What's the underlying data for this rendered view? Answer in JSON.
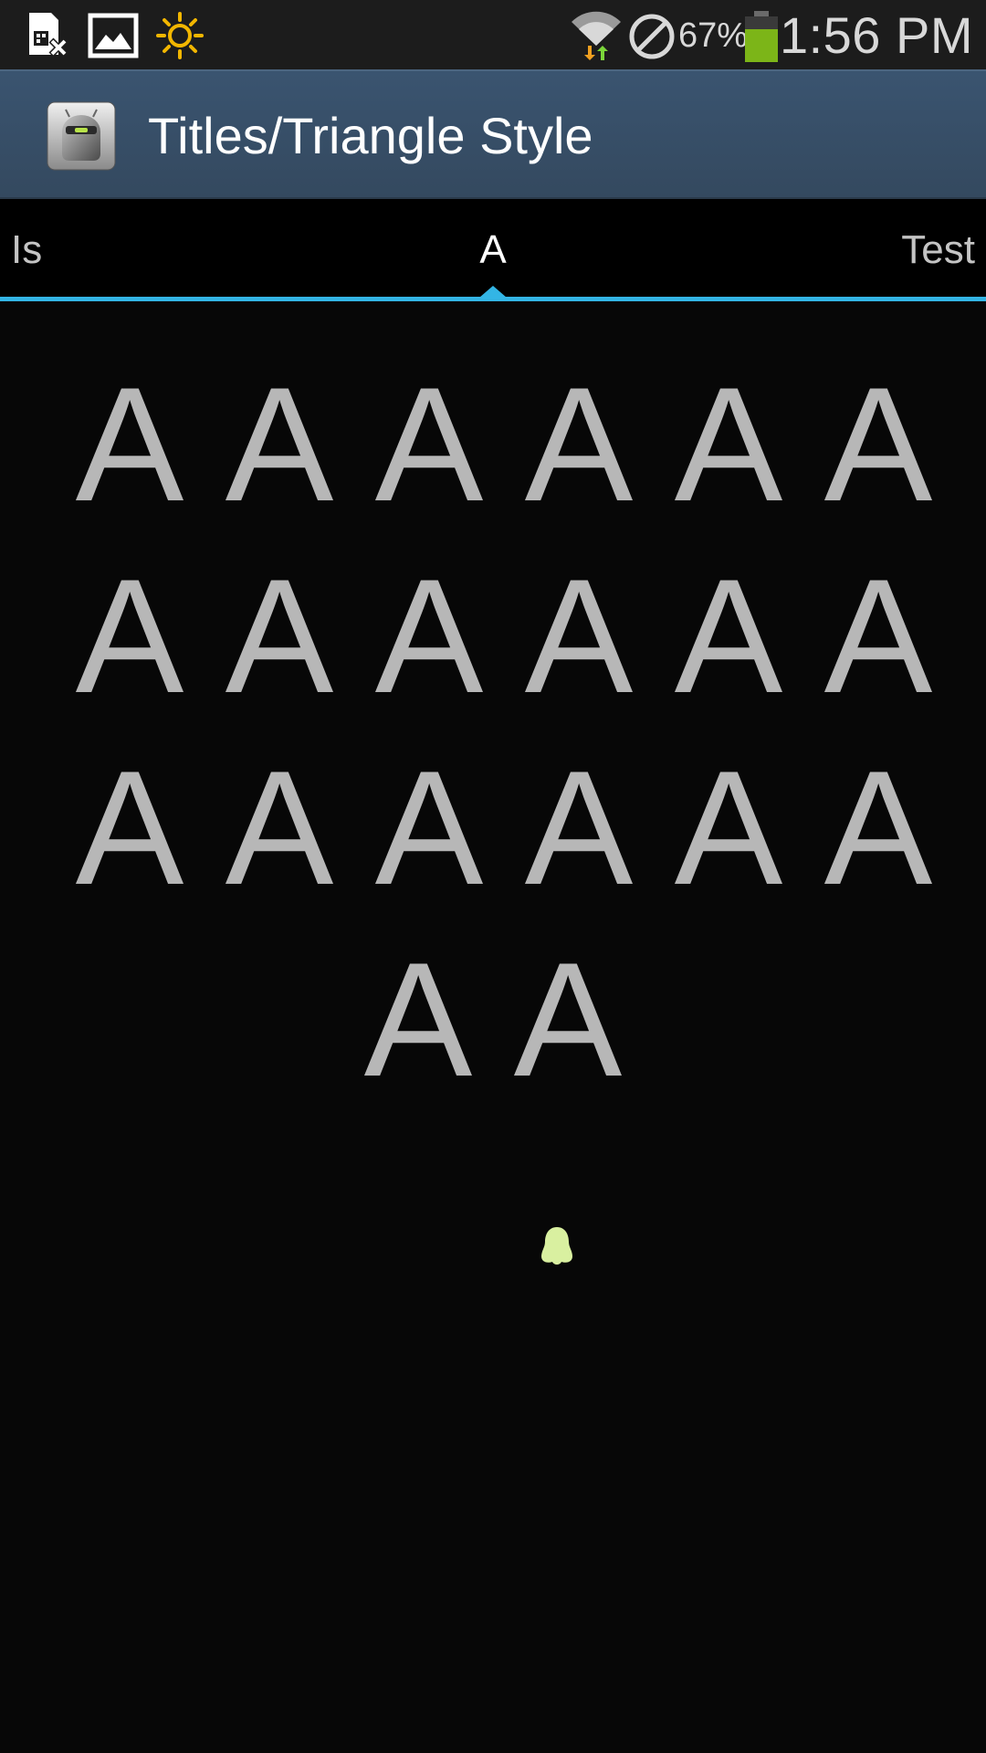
{
  "status_bar": {
    "icons": [
      "sim-card-missing-icon",
      "image-icon",
      "brightness-icon",
      "wifi-icon",
      "blocked-icon",
      "battery-icon"
    ],
    "battery_percent": "67%",
    "time": "1:56 PM"
  },
  "action_bar": {
    "title": "Titles/Triangle Style",
    "app_icon": "android-robot-icon"
  },
  "title_indicator": {
    "prev_label": "Is",
    "current_label": "A",
    "next_label": "Test",
    "accent_color": "#33b5e5"
  },
  "content": {
    "rows": [
      [
        "A",
        "A",
        "A",
        "A",
        "A",
        "A"
      ],
      [
        "A",
        "A",
        "A",
        "A",
        "A",
        "A"
      ],
      [
        "A",
        "A",
        "A",
        "A",
        "A",
        "A"
      ],
      [
        "A",
        "A"
      ]
    ],
    "text_color": "#b7b7b7"
  }
}
